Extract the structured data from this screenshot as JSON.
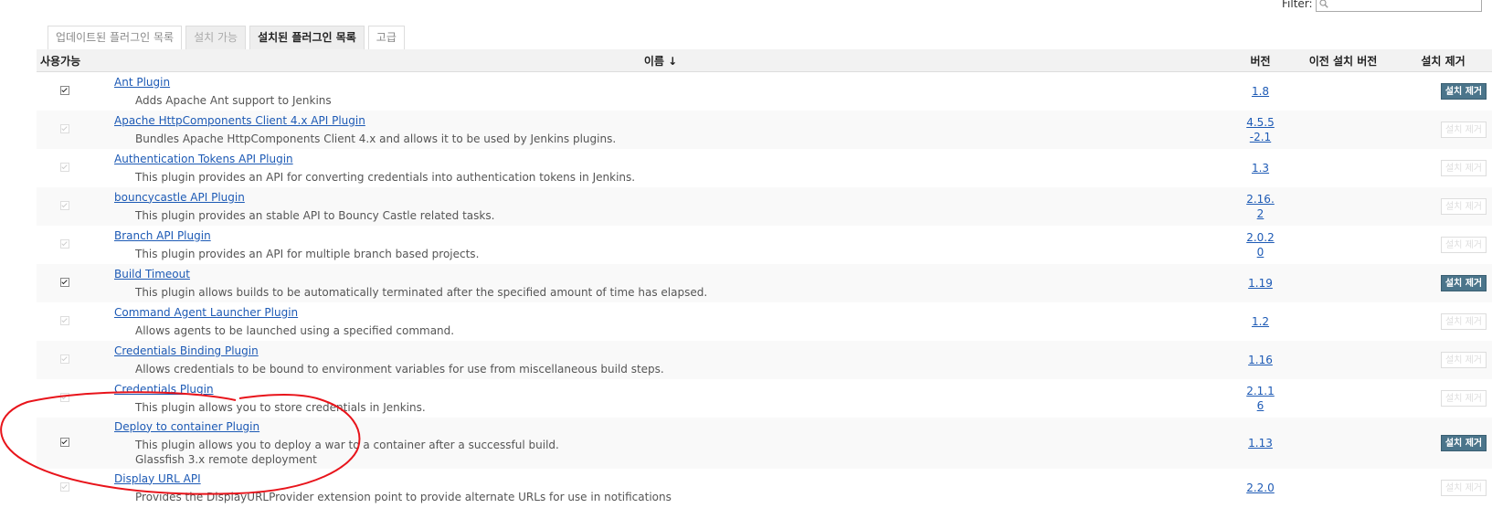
{
  "filter": {
    "label": "Filter:",
    "value": ""
  },
  "tabs": [
    {
      "label": "업데이트된 플러그인 목록",
      "state": "normal"
    },
    {
      "label": "설치 가능",
      "state": "disabled"
    },
    {
      "label": "설치된 플러그인 목록",
      "state": "active"
    },
    {
      "label": "고급",
      "state": "normal"
    }
  ],
  "table": {
    "headers": {
      "enabled": "사용가능",
      "name": "이름 ↓",
      "version": "버전",
      "previous": "이전 설치 버전",
      "uninstall": "설치 제거"
    },
    "uninstall_label": "설치 제거",
    "rows": [
      {
        "name": "Ant Plugin",
        "desc": "Adds Apache Ant support to Jenkins",
        "version": "1.8",
        "checked": true,
        "removable": true
      },
      {
        "name": "Apache HttpComponents Client 4.x API Plugin",
        "desc": "Bundles Apache HttpComponents Client 4.x and allows it to be used by Jenkins plugins.",
        "version": "4.5.5-2.1",
        "checked": true,
        "removable": false
      },
      {
        "name": "Authentication Tokens API Plugin",
        "desc": "This plugin provides an API for converting credentials into authentication tokens in Jenkins.",
        "version": "1.3",
        "checked": true,
        "removable": false
      },
      {
        "name": "bouncycastle API Plugin",
        "desc": "This plugin provides an stable API to Bouncy Castle related tasks.",
        "version": "2.16.2",
        "checked": true,
        "removable": false
      },
      {
        "name": "Branch API Plugin",
        "desc": "This plugin provides an API for multiple branch based projects.",
        "version": "2.0.20",
        "checked": true,
        "removable": false
      },
      {
        "name": "Build Timeout",
        "desc": "This plugin allows builds to be automatically terminated after the specified amount of time has elapsed.",
        "version": "1.19",
        "checked": true,
        "removable": true
      },
      {
        "name": "Command Agent Launcher Plugin",
        "desc": "Allows agents to be launched using a specified command.",
        "version": "1.2",
        "checked": true,
        "removable": false
      },
      {
        "name": "Credentials Binding Plugin",
        "desc": "Allows credentials to be bound to environment variables for use from miscellaneous build steps.",
        "version": "1.16",
        "checked": true,
        "removable": false
      },
      {
        "name": "Credentials Plugin",
        "desc": "This plugin allows you to store credentials in Jenkins.",
        "version": "2.1.16",
        "checked": true,
        "removable": false
      },
      {
        "name": "Deploy to container Plugin",
        "desc": "This plugin allows you to deploy a war to a container after a successful build.",
        "desc2": "Glassfish 3.x remote deployment",
        "version": "1.13",
        "checked": true,
        "removable": true
      },
      {
        "name": "Display URL API",
        "desc": "Provides the DisplayURLProvider extension point to provide alternate URLs for use in notifications",
        "version": "2.2.0",
        "checked": true,
        "removable": false
      }
    ]
  },
  "annotation": {
    "shape": "freehand-ellipse",
    "color": "#e8141b",
    "target": "Deploy to container Plugin"
  }
}
